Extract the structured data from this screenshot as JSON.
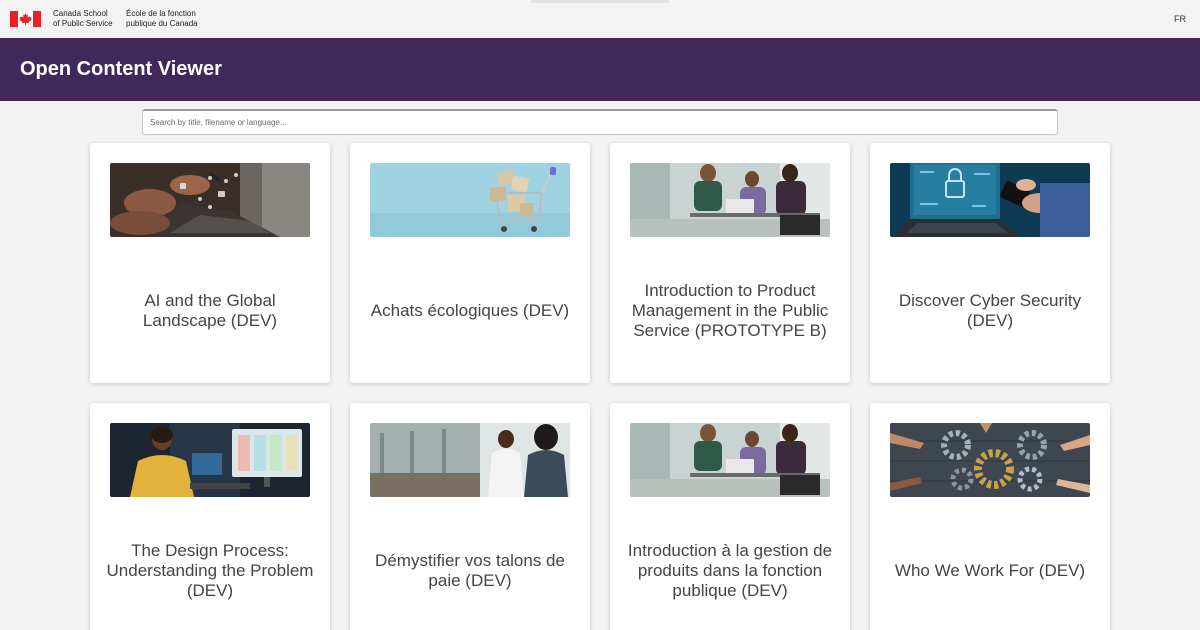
{
  "header": {
    "org_en_line1": "Canada School",
    "org_en_line2": "of Public Service",
    "org_fr_line1": "École de la fonction",
    "org_fr_line2": "publique du Canada",
    "language_toggle": "FR",
    "title": "Open Content Viewer"
  },
  "search": {
    "placeholder": "Search by title, filename or language..."
  },
  "colors": {
    "header_bg": "#40285a",
    "flag_red": "#e8202a"
  },
  "cards": [
    {
      "title": "AI and the Global Landscape (DEV)",
      "image": "hands-on-laptop-ai-image"
    },
    {
      "title": "Achats écologiques (DEV)",
      "image": "shopping-cart-boxes-image"
    },
    {
      "title": "Introduction to Product Management in the Public Service (PROTOTYPE B)",
      "image": "team-meeting-image"
    },
    {
      "title": "Discover Cyber Security (DEV)",
      "image": "cyber-security-laptop-image"
    },
    {
      "title": "The Design Process: Understanding the Problem (DEV)",
      "image": "designer-at-monitor-image"
    },
    {
      "title": "Démystifier vos talons de paie (DEV)",
      "image": "office-conversation-image"
    },
    {
      "title": "Introduction à la gestion de produits dans la fonction publique (DEV)",
      "image": "team-meeting-image"
    },
    {
      "title": "Who We Work For (DEV)",
      "image": "hands-with-gears-image"
    }
  ]
}
